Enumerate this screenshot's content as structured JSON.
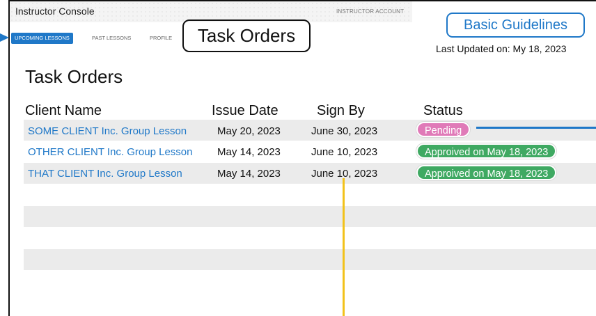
{
  "app": {
    "title": "Instructor Console",
    "account_label": "INSTRUCTOR ACCOUNT"
  },
  "nav": {
    "tabs": [
      {
        "label": "UPCOMING LESSONS",
        "active": true
      },
      {
        "label": "PAST LESSONS",
        "active": false
      },
      {
        "label": "PROFILE",
        "active": false
      }
    ]
  },
  "callout": {
    "section_label": "Task Orders"
  },
  "guidelines": {
    "button_label": "Basic Guidelines",
    "last_updated": "Last Updated on: My 18, 2023"
  },
  "page": {
    "title": "Task Orders"
  },
  "table": {
    "columns": [
      "Client Name",
      "Issue Date",
      "Sign By",
      "Status"
    ],
    "rows": [
      {
        "client": "SOME CLIENT Inc. Group Lesson",
        "issue_date": "May 20, 2023",
        "sign_by": "June 30, 2023",
        "status": "Pending"
      },
      {
        "client": "OTHER CLIENT Inc. Group Lesson",
        "issue_date": "May 14, 2023",
        "sign_by": "June 10, 2023",
        "status": "Approived on May 18, 2023"
      },
      {
        "client": "THAT CLIENT Inc. Group Lesson",
        "issue_date": "May 14, 2023",
        "sign_by": "June 10, 2023",
        "status": "Approived on May 18, 2023"
      }
    ]
  },
  "colors": {
    "accent": "#1f78c8",
    "pending": "#e07ab8",
    "approved": "#3fa962",
    "annotation_yellow": "#f2c21b",
    "row_stripe": "#ebebeb"
  }
}
